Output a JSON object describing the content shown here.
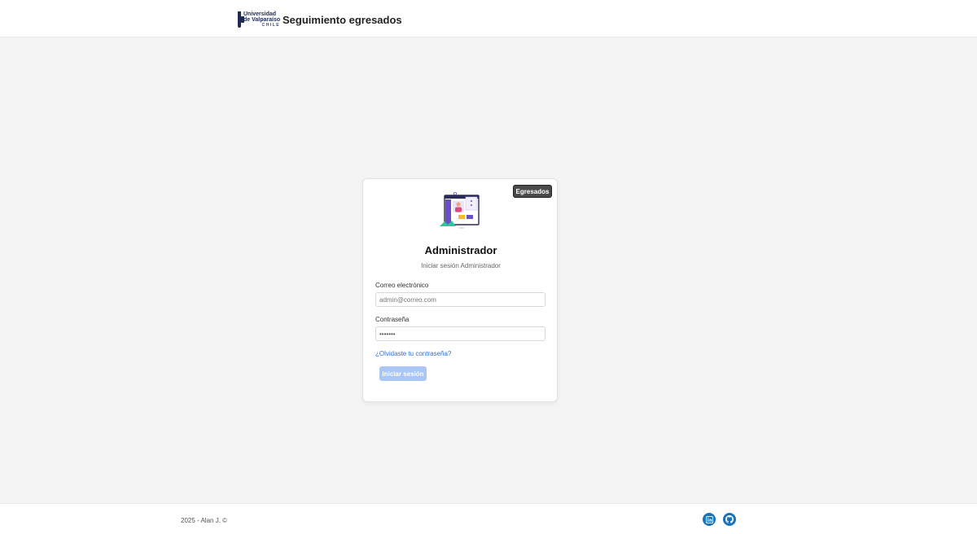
{
  "header": {
    "logo": {
      "line1": "Universidad",
      "line2": "de Valparaíso",
      "line3": "CHILE"
    },
    "title": "Seguimiento egresados"
  },
  "login": {
    "badge": "Egresados",
    "title": "Administrador",
    "subtitle": "Iniciar sesión Administrador",
    "email": {
      "label": "Correo electrónico",
      "placeholder": "admin@correo.com",
      "value": ""
    },
    "password": {
      "label": "Contraseña",
      "value": "•••••••"
    },
    "forgot_link": "¿Olvidaste tu contraseña?",
    "submit_label": "Iniciar sesión"
  },
  "footer": {
    "copyright": "2025 - Alan J. ©",
    "social": [
      {
        "icon": "linkedin-icon"
      },
      {
        "icon": "github-icon"
      }
    ]
  },
  "colors": {
    "background": "#f4f4f4",
    "badge": "#4a4a4a",
    "link": "#2f6fd6",
    "button_disabled": "#a9c6f6",
    "social": "#1a73b8"
  }
}
